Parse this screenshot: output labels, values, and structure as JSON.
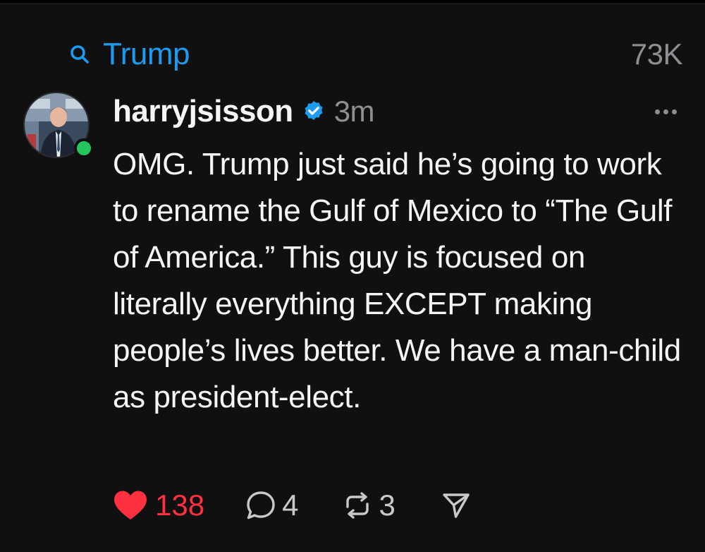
{
  "search": {
    "term": "Trump",
    "result_count": "73K"
  },
  "post": {
    "username": "harryjsisson",
    "verified": true,
    "timestamp": "3m",
    "text": "OMG. Trump just said he’s going to work to rename the Gulf of Mexico to “The Gulf of America.” This guy is focused on literally everything EXCEPT making people’s lives better. We have a man-child as president-elect.",
    "likes": "138",
    "liked": true,
    "replies": "4",
    "reposts": "3"
  },
  "colors": {
    "accent": "#1d9bf0",
    "like": "#ff3040",
    "online": "#22c55e",
    "background": "#101010"
  },
  "icons": [
    "search-icon",
    "verified-badge-icon",
    "more-icon",
    "heart-icon",
    "comment-icon",
    "repost-icon",
    "share-icon"
  ]
}
